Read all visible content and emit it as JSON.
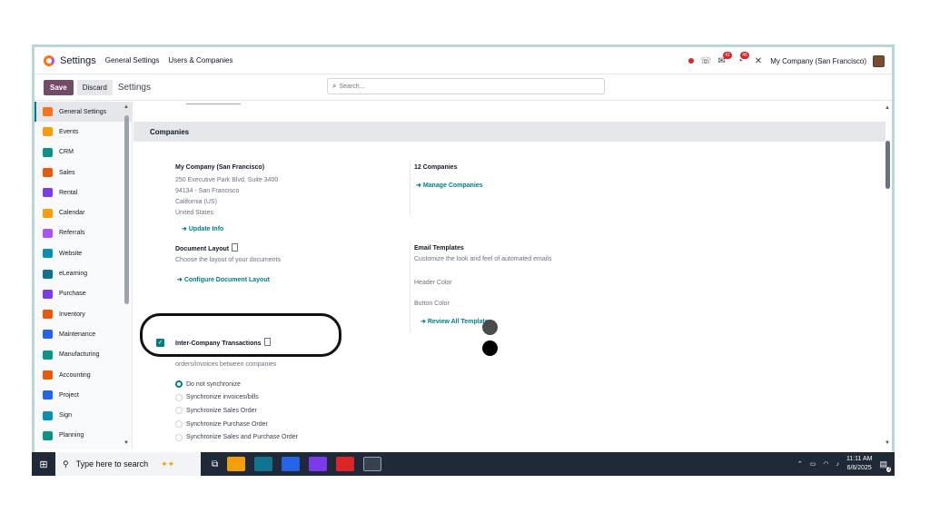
{
  "navbar": {
    "app_title": "Settings",
    "links": [
      "General Settings",
      "Users & Companies"
    ],
    "chat_badge": "41",
    "activity_badge": "46",
    "company": "My Company (San Francisco)"
  },
  "control": {
    "save": "Save",
    "discard": "Discard",
    "title": "Settings",
    "search_placeholder": "Search..."
  },
  "sidebar": {
    "items": [
      {
        "label": "General Settings",
        "color": "#f97316"
      },
      {
        "label": "Events",
        "color": "#f59e0b"
      },
      {
        "label": "CRM",
        "color": "#0d9488"
      },
      {
        "label": "Sales",
        "color": "#ea580c"
      },
      {
        "label": "Rental",
        "color": "#7c3aed"
      },
      {
        "label": "Calendar",
        "color": "#f59e0b"
      },
      {
        "label": "Referrals",
        "color": "#a855f7"
      },
      {
        "label": "Website",
        "color": "#0891b2"
      },
      {
        "label": "eLearning",
        "color": "#0e7490"
      },
      {
        "label": "Purchase",
        "color": "#7c3aed"
      },
      {
        "label": "Inventory",
        "color": "#ea580c"
      },
      {
        "label": "Maintenance",
        "color": "#2563eb"
      },
      {
        "label": "Manufacturing",
        "color": "#0d9488"
      },
      {
        "label": "Accounting",
        "color": "#ea580c"
      },
      {
        "label": "Project",
        "color": "#2563eb"
      },
      {
        "label": "Sign",
        "color": "#0891b2"
      },
      {
        "label": "Planning",
        "color": "#0d9488"
      }
    ]
  },
  "main": {
    "section_title": "Companies",
    "company": {
      "name": "My Company (San Francisco)",
      "addr1": "250 Executive Park Blvd, Suite 3400",
      "addr2": "94134 - San Francisco",
      "addr3": "California (US)",
      "addr4": "United States",
      "update": "Update Info"
    },
    "companies": {
      "count": "12 Companies",
      "manage": "Manage Companies"
    },
    "doc_layout": {
      "title": "Document Layout",
      "desc": "Choose the layout of your documents",
      "link": "Configure Document Layout"
    },
    "email": {
      "title": "Email Templates",
      "desc": "Customize the look and feel of automated emails",
      "header_color_label": "Header Color",
      "header_color": "#4b4b4b",
      "button_color_label": "Button Color",
      "button_color": "#000000",
      "review": "Review All Templates"
    },
    "intercompany": {
      "title": "Inter-Company Transactions",
      "desc": "orders/invoices between companies",
      "options": [
        "Do not synchronize",
        "Synchronize invoices/bills",
        "Synchronize Sales Order",
        "Synchronize Purchase Order",
        "Synchronize Sales and Purchase Order"
      ],
      "selected": "Do not synchronize"
    }
  },
  "taskbar": {
    "search": "Type here to search",
    "time": "11:11 AM",
    "date": "6/6/2025",
    "notif": "3"
  }
}
